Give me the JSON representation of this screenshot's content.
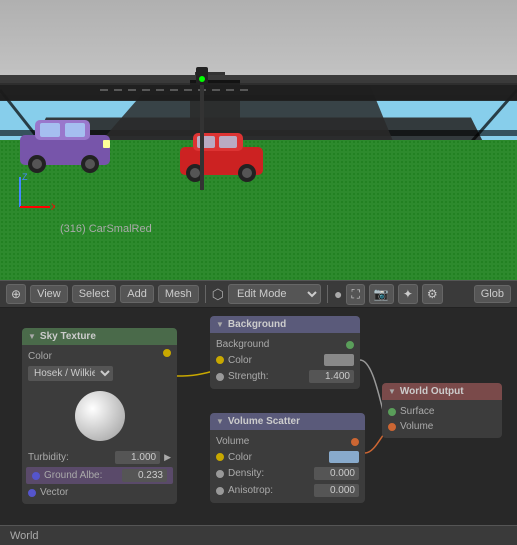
{
  "viewport": {
    "obj_name": "(316) CarSmalRed",
    "axis_x": "X",
    "axis_y": "Y",
    "axis_z": "Z"
  },
  "toolbar": {
    "view_label": "View",
    "select_label": "Select",
    "add_label": "Add",
    "mesh_label": "Mesh",
    "mode_label": "Edit Mode",
    "global_label": "Glob"
  },
  "nodes": {
    "sky_texture": {
      "title": "Sky Texture",
      "color_label": "Color",
      "preset_label": "Hosek / Wilkie",
      "turbidity_label": "Turbidity:",
      "turbidity_value": "1.000",
      "ground_label": "Ground Albe:",
      "ground_value": "0.233",
      "vector_label": "Vector"
    },
    "background": {
      "title": "Background",
      "background_label": "Background",
      "color_label": "Color",
      "strength_label": "Strength:",
      "strength_value": "1.400"
    },
    "volume_scatter": {
      "title": "Volume Scatter",
      "volume_label": "Volume",
      "color_label": "Color",
      "density_label": "Density:",
      "density_value": "0.000",
      "anisotropy_label": "Anisotrop:",
      "anisotropy_value": "0.000"
    },
    "world_output": {
      "title": "World Output",
      "surface_label": "Surface",
      "volume_label": "Volume"
    }
  },
  "world_label": "World"
}
